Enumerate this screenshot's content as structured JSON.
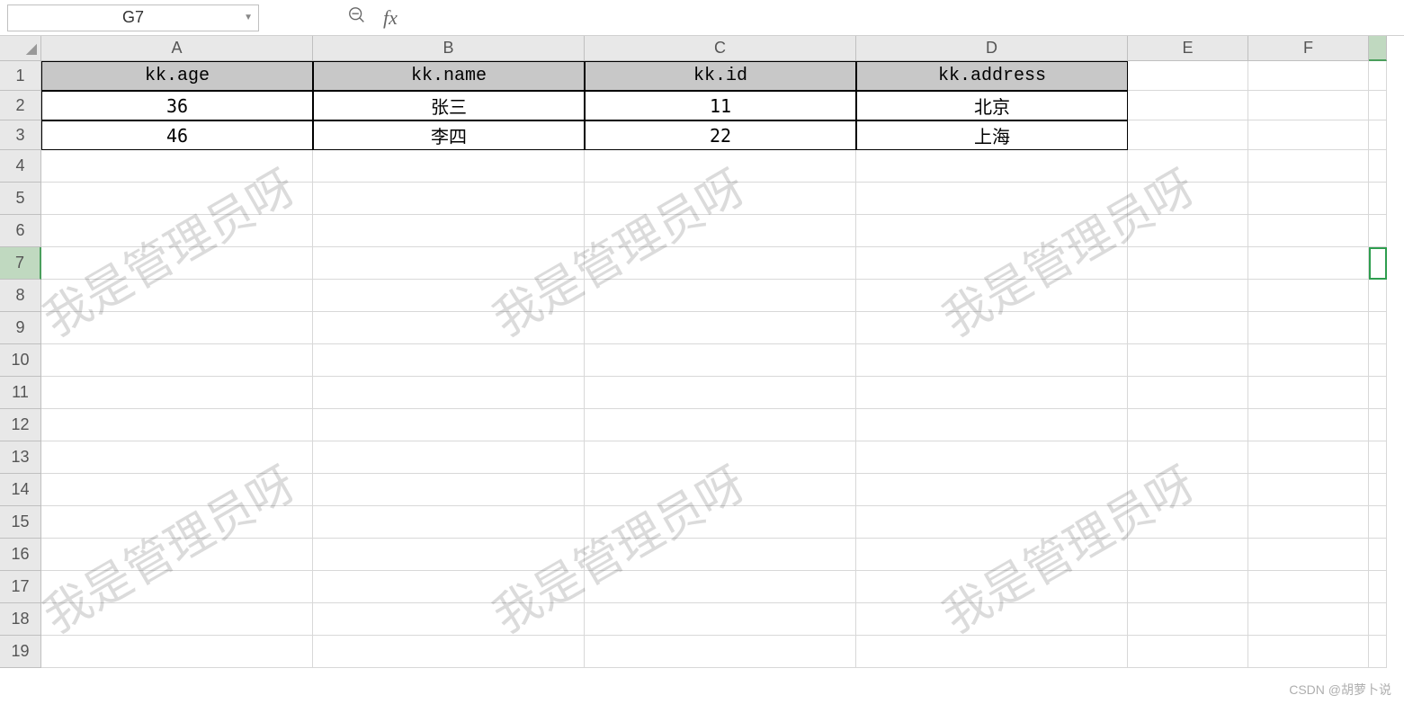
{
  "formula_bar": {
    "name_box": "G7",
    "fx_label": "fx"
  },
  "columns": [
    "A",
    "B",
    "C",
    "D",
    "E",
    "F"
  ],
  "row_labels": [
    "1",
    "2",
    "3",
    "4",
    "5",
    "6",
    "7",
    "8",
    "9",
    "10",
    "11",
    "12",
    "13",
    "14",
    "15",
    "16",
    "17",
    "18",
    "19"
  ],
  "active_cell": "G7",
  "headers": {
    "A": "kk.age",
    "B": "kk.name",
    "C": "kk.id",
    "D": "kk.address"
  },
  "table_rows": [
    {
      "A": "36",
      "B": "张三",
      "C": "11",
      "D": "北京"
    },
    {
      "A": "46",
      "B": "李四",
      "C": "22",
      "D": "上海"
    }
  ],
  "watermark_text": "我是管理员呀",
  "footer_text": "CSDN @胡萝卜说"
}
